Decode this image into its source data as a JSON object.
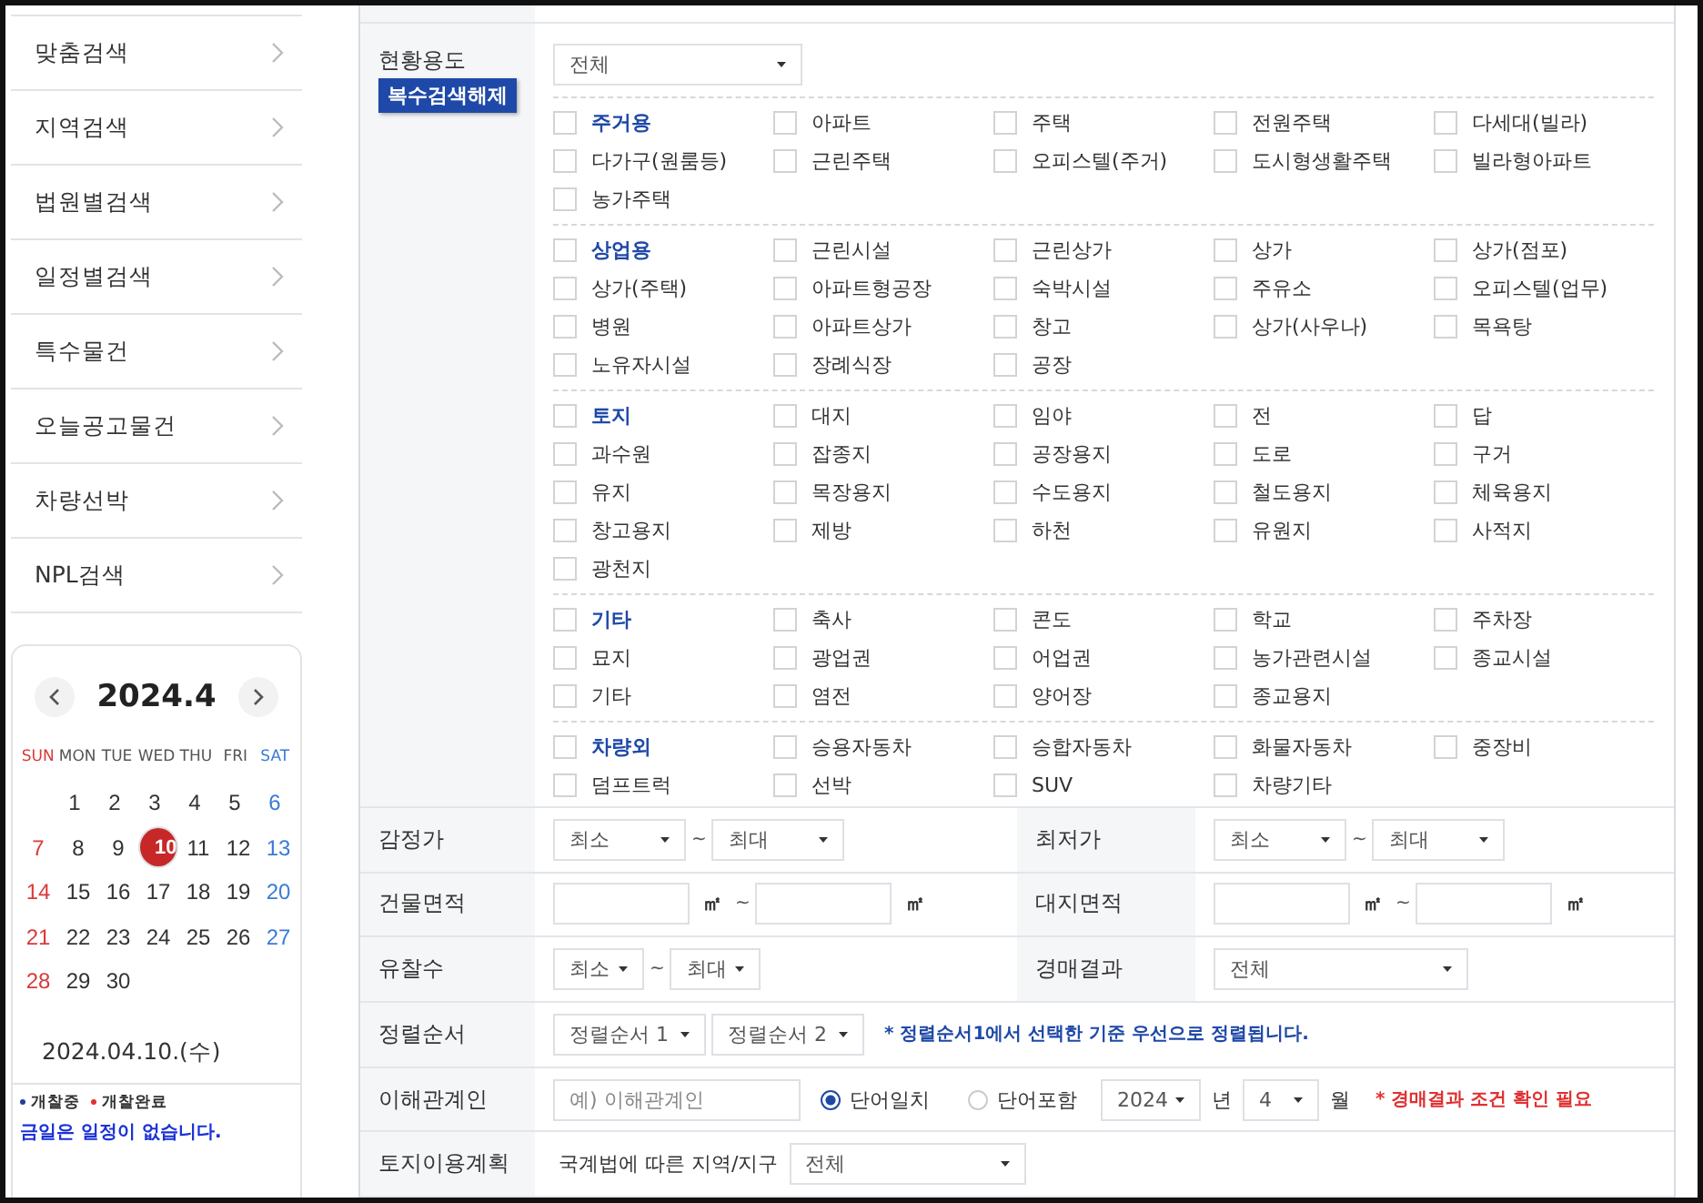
{
  "sidebar": {
    "menu": [
      {
        "label": "맞춤검색"
      },
      {
        "label": "지역검색"
      },
      {
        "label": "법원별검색"
      },
      {
        "label": "일정별검색"
      },
      {
        "label": "특수물건"
      },
      {
        "label": "오늘공고물건"
      },
      {
        "label": "차량선박"
      },
      {
        "label": "NPL검색"
      }
    ],
    "calendar": {
      "title": "2024.4",
      "weekdays": [
        {
          "label": "SUN",
          "kind": "sun"
        },
        {
          "label": "MON",
          "kind": "weekday"
        },
        {
          "label": "TUE",
          "kind": "weekday"
        },
        {
          "label": "WED",
          "kind": "weekday"
        },
        {
          "label": "THU",
          "kind": "weekday"
        },
        {
          "label": "FRI",
          "kind": "weekday"
        },
        {
          "label": "SAT",
          "kind": "sat"
        }
      ],
      "weeks": [
        [
          {
            "day": "1",
            "kind": "weekday",
            "selected": false
          },
          {
            "day": "2",
            "kind": "weekday",
            "selected": false
          },
          {
            "day": "3",
            "kind": "weekday",
            "selected": false
          },
          {
            "day": "4",
            "kind": "weekday",
            "selected": false
          },
          {
            "day": "5",
            "kind": "weekday",
            "selected": false
          },
          {
            "day": "6",
            "kind": "sat",
            "selected": false
          }
        ],
        [
          {
            "day": "7",
            "kind": "sun",
            "selected": false
          },
          {
            "day": "8",
            "kind": "weekday",
            "selected": false
          },
          {
            "day": "9",
            "kind": "weekday",
            "selected": false
          },
          {
            "day": "10",
            "kind": "weekday",
            "selected": true
          },
          {
            "day": "11",
            "kind": "weekday",
            "selected": false
          },
          {
            "day": "12",
            "kind": "weekday",
            "selected": false
          },
          {
            "day": "13",
            "kind": "sat",
            "selected": false
          }
        ],
        [
          {
            "day": "14",
            "kind": "sun",
            "selected": false
          },
          {
            "day": "15",
            "kind": "weekday",
            "selected": false
          },
          {
            "day": "16",
            "kind": "weekday",
            "selected": false
          },
          {
            "day": "17",
            "kind": "weekday",
            "selected": false
          },
          {
            "day": "18",
            "kind": "weekday",
            "selected": false
          },
          {
            "day": "19",
            "kind": "weekday",
            "selected": false
          },
          {
            "day": "20",
            "kind": "sat",
            "selected": false
          }
        ],
        [
          {
            "day": "21",
            "kind": "sun",
            "selected": false
          },
          {
            "day": "22",
            "kind": "weekday",
            "selected": false
          },
          {
            "day": "23",
            "kind": "weekday",
            "selected": false
          },
          {
            "day": "24",
            "kind": "weekday",
            "selected": false
          },
          {
            "day": "25",
            "kind": "weekday",
            "selected": false
          },
          {
            "day": "26",
            "kind": "weekday",
            "selected": false
          },
          {
            "day": "27",
            "kind": "sat",
            "selected": false
          }
        ],
        [
          {
            "day": "28",
            "kind": "sun",
            "selected": false
          },
          {
            "day": "29",
            "kind": "weekday",
            "selected": false
          },
          {
            "day": "30",
            "kind": "weekday",
            "selected": false
          }
        ]
      ],
      "date": "2024.04.10.(수)",
      "legend": [
        {
          "label": "개찰중",
          "color": "#1e3f9e"
        },
        {
          "label": "개찰완료",
          "color": "#e03131"
        }
      ],
      "notice": "금일은 일정이 없습니다."
    }
  },
  "usage": {
    "label": "현황용도",
    "clear_button": "복수검색해제",
    "select": "전체",
    "groups": [
      {
        "items": [
          {
            "label": "주거용",
            "kind": "category",
            "checked": false
          },
          {
            "label": "아파트",
            "kind": "option",
            "checked": false
          },
          {
            "label": "주택",
            "kind": "option",
            "checked": false
          },
          {
            "label": "전원주택",
            "kind": "option",
            "checked": false
          },
          {
            "label": "다세대(빌라)",
            "kind": "option",
            "checked": false
          },
          {
            "label": "다가구(원룸등)",
            "kind": "option",
            "checked": false
          },
          {
            "label": "근린주택",
            "kind": "option",
            "checked": false
          },
          {
            "label": "오피스텔(주거)",
            "kind": "option",
            "checked": false
          },
          {
            "label": "도시형생활주택",
            "kind": "option",
            "checked": false
          },
          {
            "label": "빌라형아파트",
            "kind": "option",
            "checked": false
          },
          {
            "label": "농가주택",
            "kind": "option",
            "checked": false
          }
        ]
      },
      {
        "items": [
          {
            "label": "상업용",
            "kind": "category",
            "checked": false
          },
          {
            "label": "근린시설",
            "kind": "option",
            "checked": false
          },
          {
            "label": "근린상가",
            "kind": "option",
            "checked": false
          },
          {
            "label": "상가",
            "kind": "option",
            "checked": false
          },
          {
            "label": "상가(점포)",
            "kind": "option",
            "checked": false
          },
          {
            "label": "상가(주택)",
            "kind": "option",
            "checked": false
          },
          {
            "label": "아파트형공장",
            "kind": "option",
            "checked": false
          },
          {
            "label": "숙박시설",
            "kind": "option",
            "checked": false
          },
          {
            "label": "주유소",
            "kind": "option",
            "checked": false
          },
          {
            "label": "오피스텔(업무)",
            "kind": "option",
            "checked": false
          },
          {
            "label": "병원",
            "kind": "option",
            "checked": false
          },
          {
            "label": "아파트상가",
            "kind": "option",
            "checked": false
          },
          {
            "label": "창고",
            "kind": "option",
            "checked": false
          },
          {
            "label": "상가(사우나)",
            "kind": "option",
            "checked": false
          },
          {
            "label": "목욕탕",
            "kind": "option",
            "checked": false
          },
          {
            "label": "노유자시설",
            "kind": "option",
            "checked": false
          },
          {
            "label": "장례식장",
            "kind": "option",
            "checked": false
          },
          {
            "label": "공장",
            "kind": "option",
            "checked": false
          }
        ]
      },
      {
        "items": [
          {
            "label": "토지",
            "kind": "category",
            "checked": false
          },
          {
            "label": "대지",
            "kind": "option",
            "checked": false
          },
          {
            "label": "임야",
            "kind": "option",
            "checked": false
          },
          {
            "label": "전",
            "kind": "option",
            "checked": false
          },
          {
            "label": "답",
            "kind": "option",
            "checked": false
          },
          {
            "label": "과수원",
            "kind": "option",
            "checked": false
          },
          {
            "label": "잡종지",
            "kind": "option",
            "checked": false
          },
          {
            "label": "공장용지",
            "kind": "option",
            "checked": false
          },
          {
            "label": "도로",
            "kind": "option",
            "checked": false
          },
          {
            "label": "구거",
            "kind": "option",
            "checked": false
          },
          {
            "label": "유지",
            "kind": "option",
            "checked": false
          },
          {
            "label": "목장용지",
            "kind": "option",
            "checked": false
          },
          {
            "label": "수도용지",
            "kind": "option",
            "checked": false
          },
          {
            "label": "철도용지",
            "kind": "option",
            "checked": false
          },
          {
            "label": "체육용지",
            "kind": "option",
            "checked": false
          },
          {
            "label": "창고용지",
            "kind": "option",
            "checked": false
          },
          {
            "label": "제방",
            "kind": "option",
            "checked": false
          },
          {
            "label": "하천",
            "kind": "option",
            "checked": false
          },
          {
            "label": "유원지",
            "kind": "option",
            "checked": false
          },
          {
            "label": "사적지",
            "kind": "option",
            "checked": false
          },
          {
            "label": "광천지",
            "kind": "option",
            "checked": false
          }
        ]
      },
      {
        "items": [
          {
            "label": "기타",
            "kind": "category",
            "checked": false
          },
          {
            "label": "축사",
            "kind": "option",
            "checked": false
          },
          {
            "label": "콘도",
            "kind": "option",
            "checked": false
          },
          {
            "label": "학교",
            "kind": "option",
            "checked": false
          },
          {
            "label": "주차장",
            "kind": "option",
            "checked": false
          },
          {
            "label": "묘지",
            "kind": "option",
            "checked": false
          },
          {
            "label": "광업권",
            "kind": "option",
            "checked": false
          },
          {
            "label": "어업권",
            "kind": "option",
            "checked": false
          },
          {
            "label": "농가관련시설",
            "kind": "option",
            "checked": false
          },
          {
            "label": "종교시설",
            "kind": "option",
            "checked": false
          },
          {
            "label": "기타",
            "kind": "option",
            "checked": false
          },
          {
            "label": "염전",
            "kind": "option",
            "checked": false
          },
          {
            "label": "양어장",
            "kind": "option",
            "checked": false
          },
          {
            "label": "종교용지",
            "kind": "option",
            "checked": false
          }
        ]
      },
      {
        "items": [
          {
            "label": "차량외",
            "kind": "category",
            "checked": false
          },
          {
            "label": "승용자동차",
            "kind": "option",
            "checked": false
          },
          {
            "label": "승합자동차",
            "kind": "option",
            "checked": false
          },
          {
            "label": "화물자동차",
            "kind": "option",
            "checked": false
          },
          {
            "label": "중장비",
            "kind": "option",
            "checked": false
          },
          {
            "label": "덤프트럭",
            "kind": "option",
            "checked": false
          },
          {
            "label": "선박",
            "kind": "option",
            "checked": false
          },
          {
            "label": "SUV",
            "kind": "option",
            "checked": false
          },
          {
            "label": "차량기타",
            "kind": "option",
            "checked": false
          }
        ]
      }
    ]
  },
  "rows": [
    {
      "cells": [
        {
          "label": "감정가",
          "controls": [
            {
              "kind": "select",
              "value": "최소"
            },
            {
              "kind": "sep",
              "text": "~"
            },
            {
              "kind": "select",
              "value": "최대"
            }
          ]
        },
        {
          "label": "최저가",
          "controls": [
            {
              "kind": "select",
              "value": "최소"
            },
            {
              "kind": "sep",
              "text": "~"
            },
            {
              "kind": "select",
              "value": "최대"
            }
          ]
        }
      ]
    },
    {
      "cells": [
        {
          "label": "건물면적",
          "controls": [
            {
              "kind": "input"
            },
            {
              "kind": "unit",
              "text": "㎡"
            },
            {
              "kind": "sep",
              "text": "~"
            },
            {
              "kind": "input"
            },
            {
              "kind": "unit",
              "text": "㎡"
            }
          ]
        },
        {
          "label": "대지면적",
          "controls": [
            {
              "kind": "input"
            },
            {
              "kind": "unit",
              "text": "㎡"
            },
            {
              "kind": "sep",
              "text": "~"
            },
            {
              "kind": "input"
            },
            {
              "kind": "unit",
              "text": "㎡"
            }
          ]
        }
      ]
    },
    {
      "cells": [
        {
          "label": "유찰수",
          "controls": [
            {
              "kind": "select",
              "value": "최소"
            },
            {
              "kind": "sep",
              "text": "~"
            },
            {
              "kind": "select",
              "value": "최대"
            }
          ]
        },
        {
          "label": "경매결과",
          "controls": [
            {
              "kind": "select",
              "value": "전체"
            }
          ]
        }
      ]
    },
    {
      "cells": [
        {
          "label": "정렬순서",
          "controls": [
            {
              "kind": "select",
              "value": "정렬순서 1"
            },
            {
              "kind": "select",
              "value": "정렬순서 2"
            },
            {
              "kind": "info",
              "text": "* 정렬순서1에서 선택한 기준 우선으로 정렬됩니다."
            }
          ]
        }
      ]
    },
    {
      "cells": [
        {
          "label": "이해관계인",
          "controls": [
            {
              "kind": "input",
              "placeholder": "예) 이해관계인"
            },
            {
              "kind": "radio",
              "text": "단어일치",
              "selected": true
            },
            {
              "kind": "radio",
              "text": "단어포함",
              "selected": false
            },
            {
              "kind": "select",
              "value": "2024"
            },
            {
              "kind": "text",
              "text": "년"
            },
            {
              "kind": "select",
              "value": "4"
            },
            {
              "kind": "text",
              "text": "월"
            },
            {
              "kind": "warning",
              "text": "* 경매결과 조건 확인 필요"
            }
          ]
        }
      ]
    },
    {
      "cells": [
        {
          "label": "토지이용계획",
          "controls": [
            {
              "kind": "text",
              "text": "국계법에 따른 지역/지구"
            },
            {
              "kind": "select",
              "value": "전체"
            }
          ]
        }
      ]
    }
  ]
}
